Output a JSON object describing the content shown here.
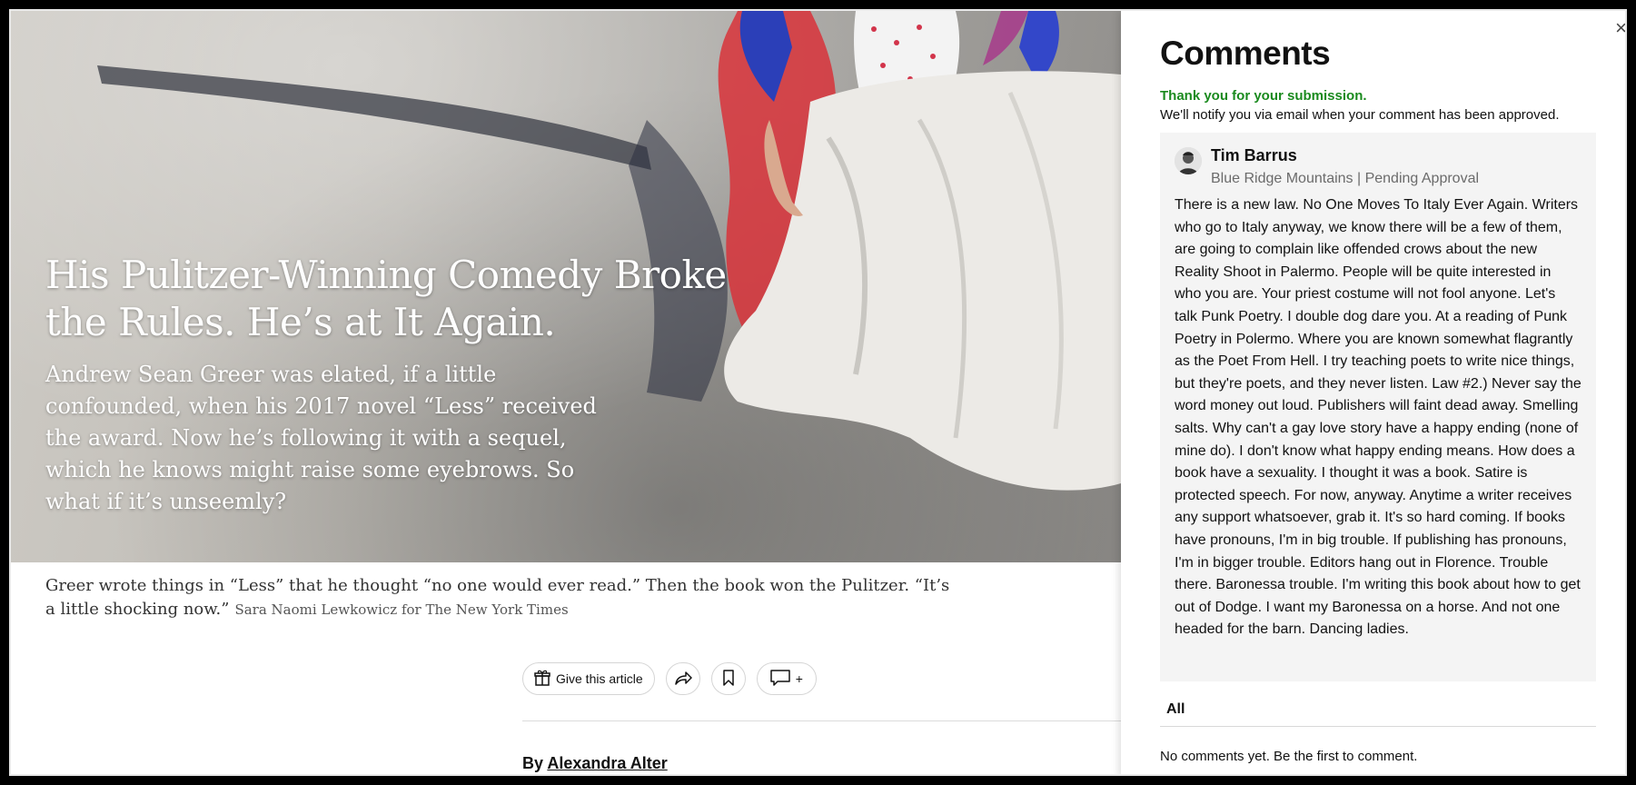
{
  "article": {
    "headline": "His Pulitzer-Winning Comedy Broke the Rules. He’s at It Again.",
    "summary": "Andrew Sean Greer was elated, if a little confounded, when his 2017 novel “Less” received the award. Now he’s following it with a sequel, which he knows might raise some eyebrows. So what if it’s unseemly?",
    "caption": "Greer wrote things in “Less” that he thought “no one would ever read.” Then the book won the Pulitzer. “It’s a little shocking now.”",
    "credit": "Sara Naomi Lewkowicz for The New York Times",
    "byline_prefix": "By",
    "author": "Alexandra Alter"
  },
  "share_bar": {
    "gift_label": "Give this article",
    "comment_plus": "+"
  },
  "comments": {
    "title": "Comments",
    "close_glyph": "×",
    "thanks": "Thank you for your submission.",
    "notify": "We'll notify you via email when your comment has been approved.",
    "pending_comment": {
      "author": "Tim Barrus",
      "meta": "Blue Ridge Mountains | Pending Approval",
      "text": "There is a new law. No One Moves To Italy Ever Again. Writers who go to Italy anyway, we know there will be a few of them, are going to complain like offended crows about the new Reality Shoot in Palermo. People will be quite interested in who you are. Your priest costume will not fool anyone. Let's talk Punk Poetry. I double dog dare you. At a reading of Punk Poetry in Polermo. Where you are known somewhat flagrantly as the Poet From Hell. I try teaching poets to write nice things, but they're poets, and they never listen. Law #2.) Never say the word money out loud. Publishers will faint dead away. Smelling salts. Why can't a gay love story have a happy ending (none of mine do). I don't know what happy ending means. How does a book have a sexuality. I thought it was a book. Satire is protected speech. For now, anyway. Anytime a writer receives any support whatsoever, grab it. It's so hard coming. If books have pronouns, I'm in big trouble. If publishing has pronouns, I'm in bigger trouble. Editors hang out in Florence. Trouble there. Baronessa trouble. I'm writing this book about how to get out of Dodge. I want my Baronessa on a horse. And not one headed for the barn. Dancing ladies."
    },
    "tab_all": "All",
    "empty_message": "No comments yet. Be the first to comment."
  },
  "colors": {
    "success_green": "#1a8a1e",
    "card_bg": "#f4f4f4"
  },
  "icons": [
    "gift-icon",
    "share-icon",
    "bookmark-icon",
    "comment-icon",
    "close-icon"
  ]
}
